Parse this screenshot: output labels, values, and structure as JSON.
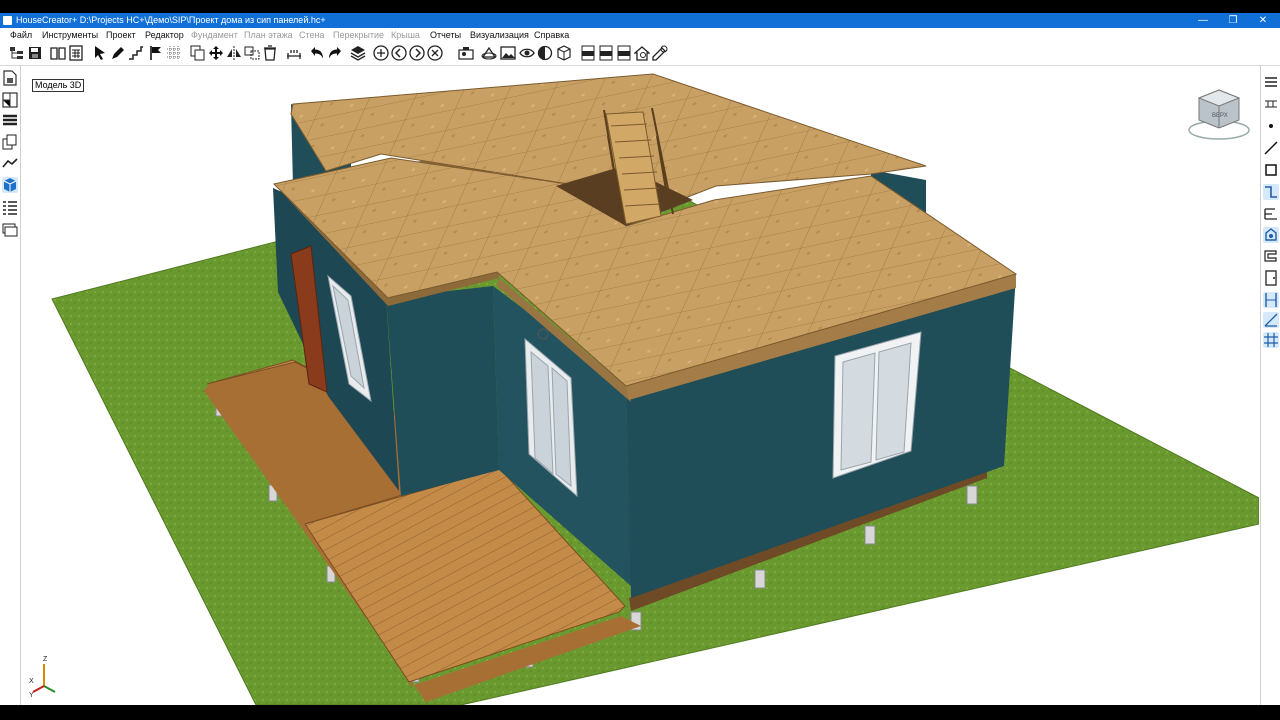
{
  "window": {
    "title": "HouseCreator+  D:\\Projects HC+\\Демо\\SIP\\Проект дома из сип панелей.hc+",
    "minimize": "—",
    "maximize": "❐",
    "close": "✕"
  },
  "menu": [
    {
      "label": "Файл",
      "enabled": true
    },
    {
      "label": "Инструменты",
      "enabled": true
    },
    {
      "label": "Проект",
      "enabled": true
    },
    {
      "label": "Редактор",
      "enabled": true
    },
    {
      "label": "Фундамент",
      "enabled": false
    },
    {
      "label": "План этажа",
      "enabled": false
    },
    {
      "label": "Стена",
      "enabled": false
    },
    {
      "label": "Перекрытие",
      "enabled": false
    },
    {
      "label": "Крыша",
      "enabled": false
    },
    {
      "label": "Отчеты",
      "enabled": true
    },
    {
      "label": "Визуализация",
      "enabled": true
    },
    {
      "label": "Справка",
      "enabled": true
    }
  ],
  "toolbar_icons": [
    "project-tree-icon",
    "save-icon",
    "book-icon",
    "calculator-icon",
    "pointer-icon",
    "pencil-icon",
    "stairs-icon",
    "flag-icon",
    "grid-icon",
    "copy-icon",
    "move-icon",
    "mirror-icon",
    "clone-icon",
    "delete-icon",
    "dimension-icon",
    "undo-icon",
    "redo-icon",
    "layers-icon",
    "zoom-in-icon",
    "zoom-out-icon",
    "zoom-next-icon",
    "zoom-close-icon",
    "walk-icon",
    "orbit-icon",
    "image-icon",
    "eye-icon",
    "contrast-icon",
    "cube-icon",
    "pdf-icon",
    "dwg-icon",
    "3ds-icon",
    "house-icon",
    "settings-icon"
  ],
  "left_tools": [
    "floor-plan-icon",
    "section-icon",
    "wall-layers-icon",
    "copy-floor-icon",
    "roof-icon",
    "model-3d-icon",
    "list-icon",
    "sheets-icon"
  ],
  "right_tools": [
    "hamburger-menu-icon",
    "wall-tool-icon",
    "point-icon",
    "line-icon",
    "rectangle-icon",
    "polyline-icon",
    "stair-tool-icon",
    "fill-tool-icon",
    "roof-tool-icon",
    "door-tool-icon",
    "measure-icon",
    "snap-grid-icon"
  ],
  "viewport": {
    "label": "Модель 3D",
    "cube_face": "ВЕРХ",
    "axes": {
      "x": "X",
      "y": "Y",
      "z": "Z"
    }
  },
  "colors": {
    "titlebar": "#1070d8",
    "grass": "#6a9a2f",
    "wall": "#1f4d58",
    "deck": "#c48a48",
    "osb": "#c9a064"
  }
}
